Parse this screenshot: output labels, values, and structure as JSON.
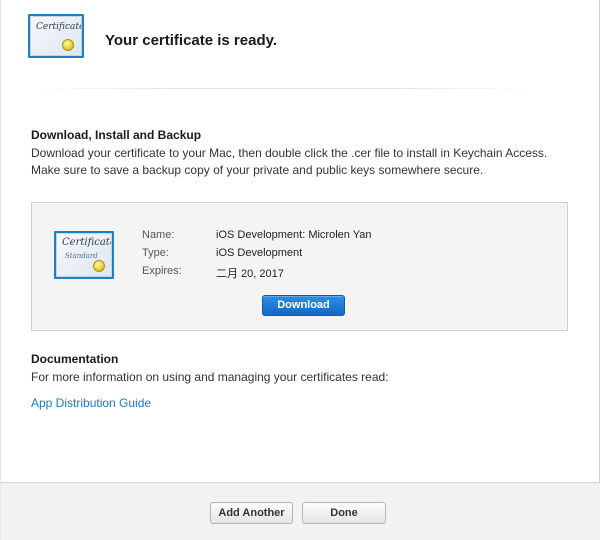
{
  "header": {
    "title": "Your certificate is ready.",
    "icon_text": "Certificate"
  },
  "download_section": {
    "title": "Download, Install and Backup",
    "text": "Download your certificate to your Mac, then double click the .cer file to install in Keychain Access. Make sure to save a backup copy of your private and public keys somewhere secure."
  },
  "certificate": {
    "icon_text": "Certificate",
    "icon_subtext": "Standard",
    "fields": [
      {
        "label": "Name:",
        "value": "iOS Development: Microlen Yan"
      },
      {
        "label": "Type:",
        "value": "iOS Development"
      },
      {
        "label": "Expires:",
        "value": "二月 20, 2017"
      }
    ],
    "download_label": "Download"
  },
  "documentation": {
    "title": "Documentation",
    "text": "For more information on using and managing your certificates read:",
    "link_label": "App Distribution Guide"
  },
  "footer": {
    "add_another_label": "Add Another",
    "done_label": "Done"
  },
  "colors": {
    "accent": "#1a7ac4",
    "button_blue": "#1469c7"
  }
}
